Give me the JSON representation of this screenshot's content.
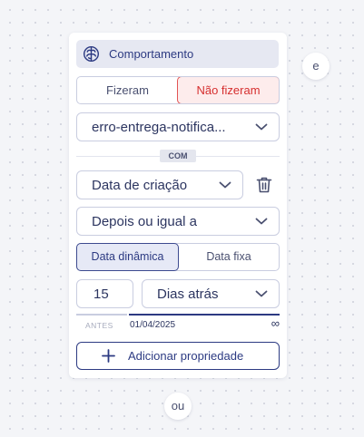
{
  "header": {
    "title": "Comportamento",
    "icon": "brain-icon"
  },
  "toggle": {
    "did": "Fizeram",
    "did_not": "Não fizeram",
    "selected": "Não fizeram"
  },
  "event_select": {
    "value": "erro-entrega-notifica..."
  },
  "with_badge": "COM",
  "property_select": {
    "value": "Data de criação"
  },
  "operator_select": {
    "value": "Depois ou igual a"
  },
  "date_type": {
    "dynamic": "Data dinâmica",
    "fixed": "Data fixa",
    "selected": "Data dinâmica"
  },
  "amount": {
    "value": "15"
  },
  "unit_select": {
    "value": "Dias atrás"
  },
  "timeline": {
    "before": "ANTES",
    "date": "01/04/2025",
    "infinity": "∞"
  },
  "add_property": {
    "label": "Adicionar propriedade"
  },
  "connectors": {
    "and": "e",
    "or": "ou"
  },
  "colors": {
    "accent": "#2c3a82",
    "danger": "#d62f2f",
    "header_bg": "#e6e8f2"
  }
}
